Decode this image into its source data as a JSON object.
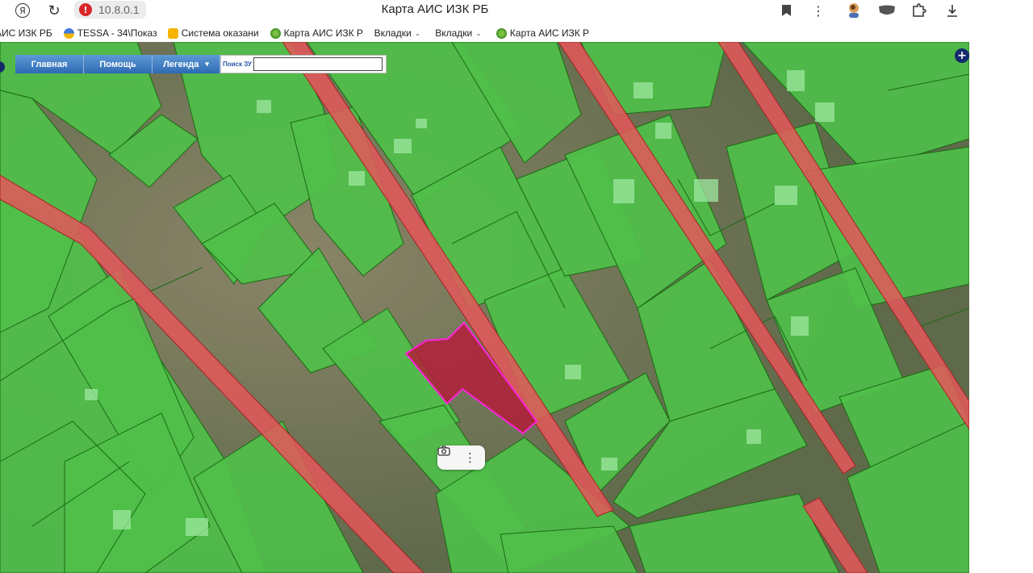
{
  "browser": {
    "url": "10.8.0.1",
    "title": "Карта АИС ИЗК РБ",
    "icons": {
      "yandex": "Я",
      "reload": "↻",
      "warning": "!",
      "bookmark": "bookmark-icon",
      "menu": "⋮",
      "ext1": "extension-avatar-icon",
      "ext2": "shield-extension-icon",
      "ext3": "puzzle-icon",
      "download": "download-icon"
    }
  },
  "bookmarks": [
    {
      "label": "АИС ИЗК РБ",
      "icon": "none"
    },
    {
      "label": "TESSA - 34\\Показ",
      "icon": "tessa-icon"
    },
    {
      "label": "Система оказани",
      "icon": "folder-yellow-icon"
    },
    {
      "label": "Карта АИС ИЗК Р",
      "icon": "leaf-icon"
    },
    {
      "label": "Вкладки",
      "icon": "none",
      "chevron": "⌄"
    },
    {
      "label": "Вкладки",
      "icon": "none",
      "chevron": "⌄"
    },
    {
      "label": "Карта АИС ИЗК Р",
      "icon": "leaf-icon"
    }
  ],
  "map_toolbar": {
    "home": "Главная",
    "help": "Помощь",
    "legend": "Легенда",
    "legend_arrow": "▾",
    "search_label": "Поиск ЗУ",
    "search_value": "",
    "zoom_in": "+"
  },
  "float_tools": {
    "camera": "📷",
    "more": "⋮"
  },
  "colors": {
    "parcel_fill": "#4fbf4a",
    "parcel_stroke": "#1a6b12",
    "road_fill": "#e0585a",
    "road_stroke": "#a82222",
    "selected_fill": "#b31f3a",
    "selected_stroke": "#ff22dd",
    "toolbar_blue": "#2e6ab3"
  }
}
